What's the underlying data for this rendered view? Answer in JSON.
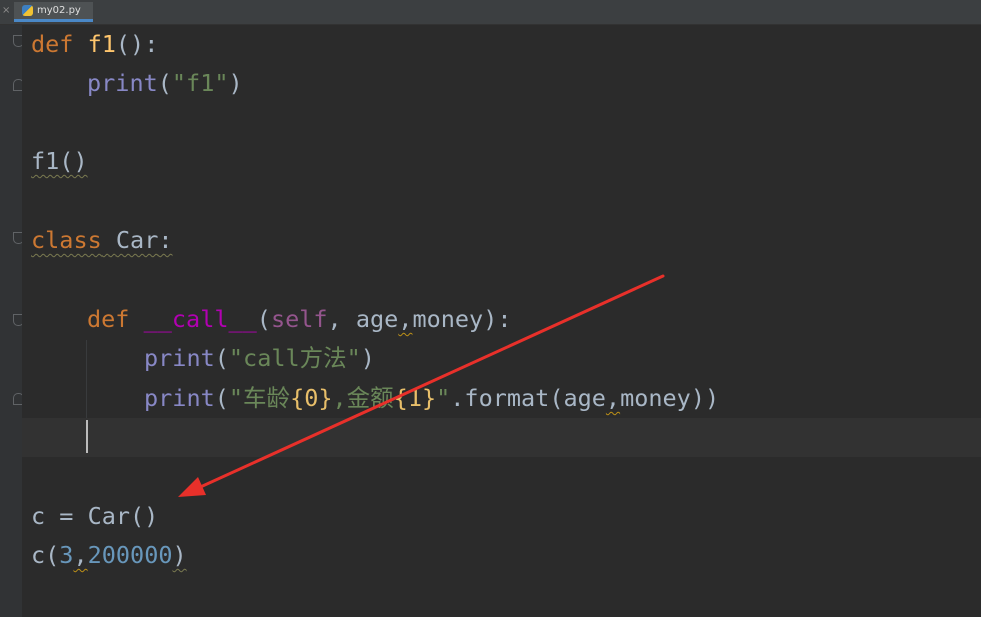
{
  "tab": {
    "filename": "my02.py",
    "close_glyph": "×",
    "icon": "python-file-icon"
  },
  "code": {
    "l1": {
      "kw": "def",
      "name": "f1",
      "rest": "():"
    },
    "l2": {
      "fn": "print",
      "open": "(",
      "str": "\"f1\"",
      "close": ")"
    },
    "l4": {
      "text": "f1()"
    },
    "l6": {
      "kw": "class",
      "name": "Car",
      "colon": ":"
    },
    "l8": {
      "kw": "def",
      "magic": "__call__",
      "open": "(",
      "self": "self",
      "sep1": ", ",
      "p1": "age",
      "comma": ",",
      "p2": "money",
      "close": "):"
    },
    "l9": {
      "fn": "print",
      "open": "(",
      "str": "\"call方法\"",
      "close": ")"
    },
    "l10": {
      "fn": "print",
      "open": "(",
      "q1": "\"车龄",
      "b0": "{0}",
      "mid": ",金额",
      "b1": "{1}",
      "q2": "\"",
      "method": ".format(",
      "a1": "age",
      "comma": ",",
      "a2": "money",
      "close": "))"
    },
    "l13": {
      "text": "c = Car()"
    },
    "l14": {
      "name": "c(",
      "n1": "3",
      "comma": ",",
      "n2": "200000",
      "close": ")"
    }
  },
  "colors": {
    "annotation_arrow": "#e8302a"
  }
}
